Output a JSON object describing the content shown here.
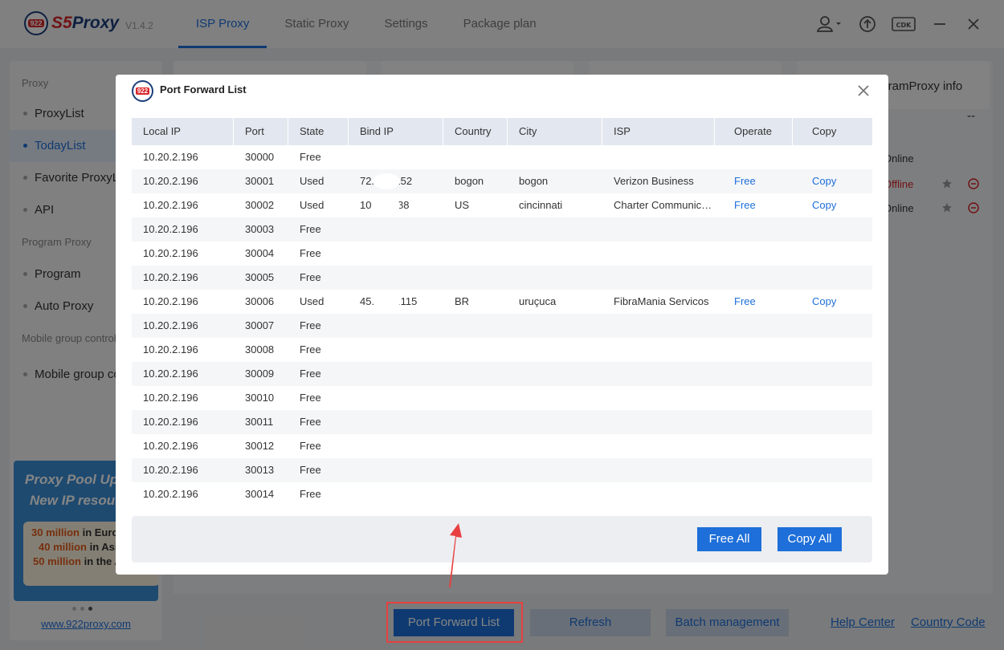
{
  "app": {
    "logo_badge": "922",
    "logo_text_s5": "S5",
    "logo_text_proxy": "Proxy",
    "version": "V1.4.2",
    "tabs": [
      "ISP Proxy",
      "Static Proxy",
      "Settings",
      "Package plan"
    ],
    "active_tab": "ISP Proxy"
  },
  "sidebar": {
    "section_proxy": "Proxy",
    "proxy_items": [
      "ProxyList",
      "TodayList",
      "Favorite ProxyList",
      "API"
    ],
    "section_program": "Program Proxy",
    "program_items": [
      "Program",
      "Auto Proxy"
    ],
    "section_mobile": "Mobile group control",
    "mobile_items": [
      "Mobile group control"
    ],
    "banner": {
      "line1": "Proxy Pool Upgrade",
      "line2": "New IP resources",
      "rows": [
        {
          "num": "30 million",
          "text": " in Europe"
        },
        {
          "num": "40 million",
          "text": " in Asia"
        },
        {
          "num": "50 million",
          "text": " in the Americas"
        }
      ]
    },
    "website": "www.922proxy.com"
  },
  "main_behind": {
    "program_proxy_info": "ProgramProxy info",
    "dash": "--",
    "online_header": "Online",
    "status_values": [
      "Offline",
      "Online"
    ]
  },
  "modal": {
    "title": "Port Forward List",
    "columns": [
      "Local IP",
      "Port",
      "State",
      "Bind IP",
      "Country",
      "City",
      "ISP",
      "Operate",
      "Copy"
    ],
    "rows": [
      {
        "local_ip": "10.20.2.196",
        "port": "30000",
        "state": "Free",
        "bind_ip": "",
        "country": "",
        "city": "",
        "isp": "",
        "operate": "",
        "copy": ""
      },
      {
        "local_ip": "10.20.2.196",
        "port": "30001",
        "state": "Used",
        "bind_ip": "72.  .12.152",
        "country": "bogon",
        "city": "bogon",
        "isp": "Verizon Business",
        "operate": "Free",
        "copy": "Copy"
      },
      {
        "local_ip": "10.20.2.196",
        "port": "30002",
        "state": "Used",
        "bind_ip": "10   .23.188",
        "country": "US",
        "city": "cincinnati",
        "isp": "Charter Communications",
        "operate": "Free",
        "copy": "Copy"
      },
      {
        "local_ip": "10.20.2.196",
        "port": "30003",
        "state": "Free",
        "bind_ip": "",
        "country": "",
        "city": "",
        "isp": "",
        "operate": "",
        "copy": ""
      },
      {
        "local_ip": "10.20.2.196",
        "port": "30004",
        "state": "Free",
        "bind_ip": "",
        "country": "",
        "city": "",
        "isp": "",
        "operate": "",
        "copy": ""
      },
      {
        "local_ip": "10.20.2.196",
        "port": "30005",
        "state": "Free",
        "bind_ip": "",
        "country": "",
        "city": "",
        "isp": "",
        "operate": "",
        "copy": ""
      },
      {
        "local_ip": "10.20.2.196",
        "port": "30006",
        "state": "Used",
        "bind_ip": "45.1   .47.115",
        "country": "BR",
        "city": "uruçuca",
        "isp": "FibraMania Servicos",
        "operate": "Free",
        "copy": "Copy"
      },
      {
        "local_ip": "10.20.2.196",
        "port": "30007",
        "state": "Free",
        "bind_ip": "",
        "country": "",
        "city": "",
        "isp": "",
        "operate": "",
        "copy": ""
      },
      {
        "local_ip": "10.20.2.196",
        "port": "30008",
        "state": "Free",
        "bind_ip": "",
        "country": "",
        "city": "",
        "isp": "",
        "operate": "",
        "copy": ""
      },
      {
        "local_ip": "10.20.2.196",
        "port": "30009",
        "state": "Free",
        "bind_ip": "",
        "country": "",
        "city": "",
        "isp": "",
        "operate": "",
        "copy": ""
      },
      {
        "local_ip": "10.20.2.196",
        "port": "30010",
        "state": "Free",
        "bind_ip": "",
        "country": "",
        "city": "",
        "isp": "",
        "operate": "",
        "copy": ""
      },
      {
        "local_ip": "10.20.2.196",
        "port": "30011",
        "state": "Free",
        "bind_ip": "",
        "country": "",
        "city": "",
        "isp": "",
        "operate": "",
        "copy": ""
      },
      {
        "local_ip": "10.20.2.196",
        "port": "30012",
        "state": "Free",
        "bind_ip": "",
        "country": "",
        "city": "",
        "isp": "",
        "operate": "",
        "copy": ""
      },
      {
        "local_ip": "10.20.2.196",
        "port": "30013",
        "state": "Free",
        "bind_ip": "",
        "country": "",
        "city": "",
        "isp": "",
        "operate": "",
        "copy": ""
      },
      {
        "local_ip": "10.20.2.196",
        "port": "30014",
        "state": "Free",
        "bind_ip": "",
        "country": "",
        "city": "",
        "isp": "",
        "operate": "",
        "copy": ""
      }
    ],
    "free_all": "Free All",
    "copy_all": "Copy All"
  },
  "bottom": {
    "port_forward_list": "Port Forward List",
    "refresh": "Refresh",
    "batch_management": "Batch management",
    "help_center": "Help Center",
    "country_code": "Country Code"
  },
  "colors": {
    "accent": "#1e6fd9",
    "annotation": "#e84040",
    "offline": "#d8252a"
  }
}
